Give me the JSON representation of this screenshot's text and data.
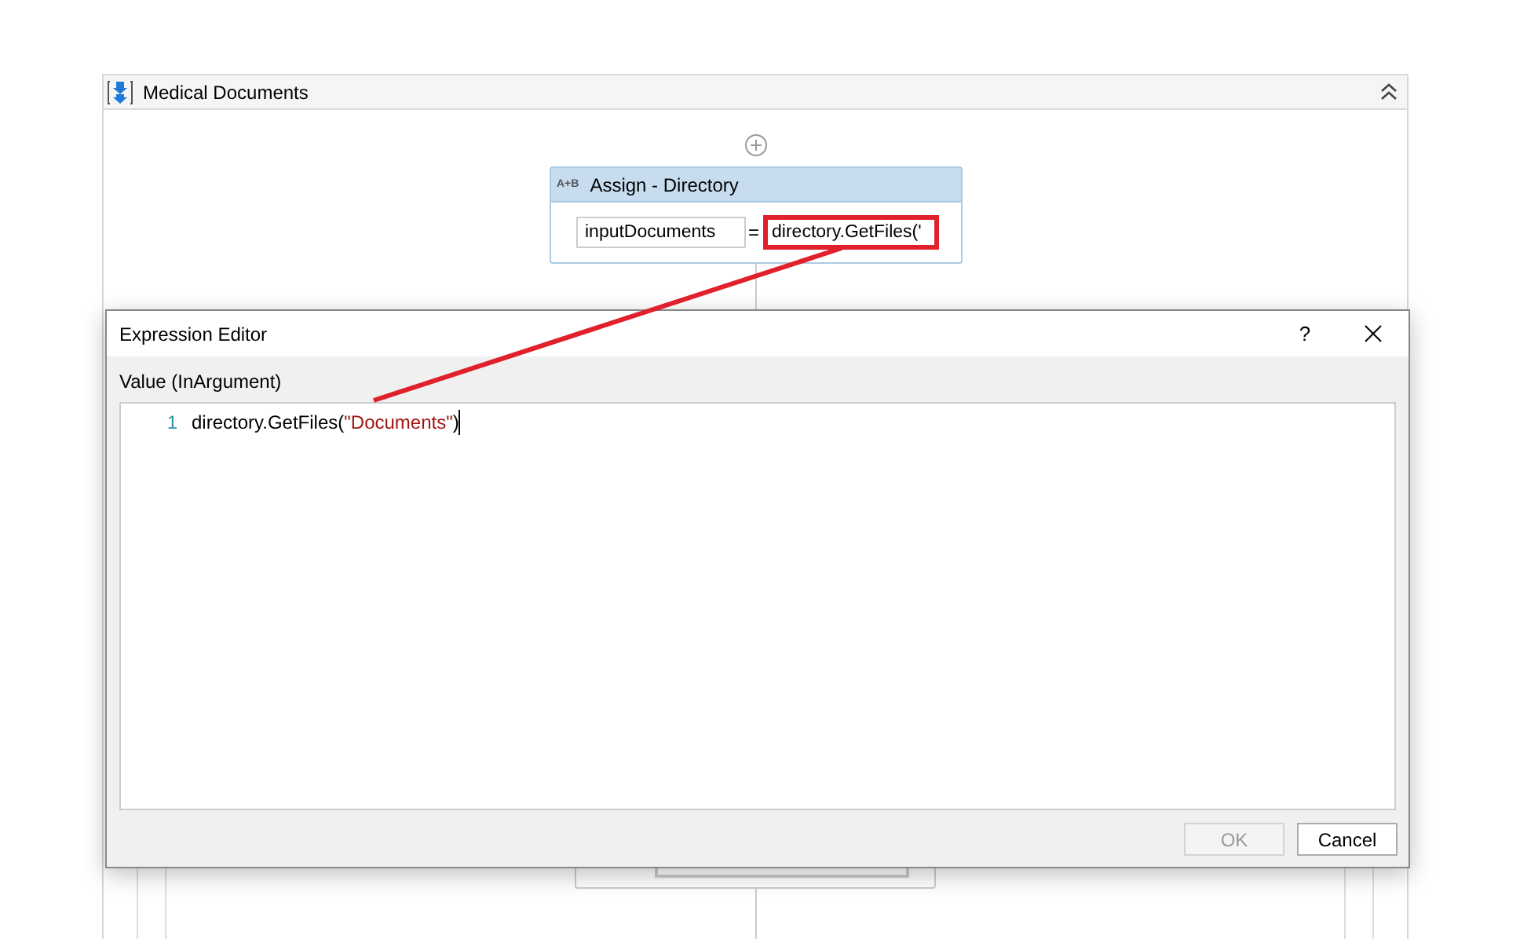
{
  "designer": {
    "title": "Medical Documents"
  },
  "assign": {
    "icon": "A+B",
    "title": "Assign - Directory",
    "target": "inputDocuments",
    "operator": "=",
    "value": "directory.GetFiles('",
    "highlighted": true
  },
  "dialog": {
    "title": "Expression Editor",
    "help": "?",
    "field_label": "Value (InArgument)",
    "lines": [
      {
        "number": "1",
        "parts": [
          {
            "text": "directory.GetFiles(",
            "kind": "code"
          },
          {
            "text": "\"Documents\"",
            "kind": "string"
          },
          {
            "text": ")",
            "kind": "code"
          }
        ]
      }
    ],
    "buttons": [
      {
        "label": "OK",
        "disabled": true
      },
      {
        "label": "Cancel",
        "disabled": false
      }
    ]
  }
}
